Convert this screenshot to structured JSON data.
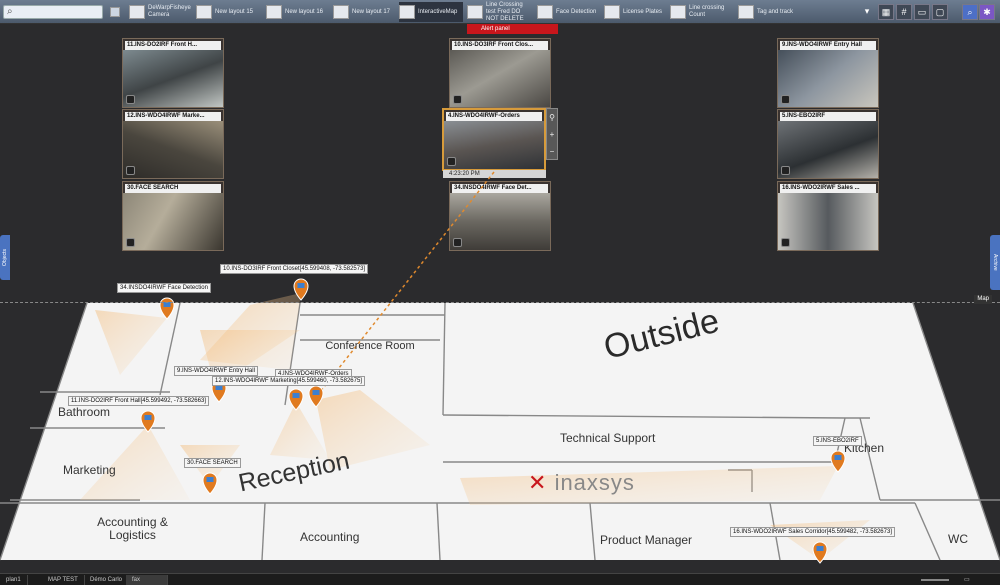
{
  "toolbar": {
    "search_placeholder": "",
    "items": [
      {
        "label": "DeWarpFisheye Camera"
      },
      {
        "label": "New layout 15"
      },
      {
        "label": "New layout 16"
      },
      {
        "label": "New layout 17"
      },
      {
        "label": "InteractiveMap"
      },
      {
        "label": "Line Crossing test Fred DO NOT DELETE"
      },
      {
        "label": "Face Detection"
      },
      {
        "label": "License Plates"
      },
      {
        "label": "Line crossing Count"
      },
      {
        "label": "Tag and track"
      }
    ]
  },
  "alert_panel": "Alert panel",
  "cameras": [
    {
      "title": "11.INS-DO2IRF Front H..."
    },
    {
      "title": "12.INS-WDO4IRWF Marke..."
    },
    {
      "title": "30.FACE SEARCH"
    },
    {
      "title": "10.INS-DO3IRF Front Clos..."
    },
    {
      "title": "4.INS-WDO4IRWF-Orders"
    },
    {
      "title": "34.INSDO4IRWF Face Det..."
    },
    {
      "title": "9.INS-WDO4IRWF Entry Hall"
    },
    {
      "title": "5.INS-EBO2IRF"
    },
    {
      "title": "16.INS-WDO2IRWF Sales ..."
    }
  ],
  "timestamp": "4:23:20 PM",
  "side_tabs": {
    "left": "Objects",
    "right": "Archive"
  },
  "map_label": "Map",
  "map": {
    "rooms": {
      "conference": "Conference Room",
      "outside": "Outside",
      "bathroom": "Bathroom",
      "technical": "Technical Support",
      "kitchen": "Kitchen",
      "marketing": "Marketing",
      "reception": "Reception",
      "accounting_logistics": "Accounting & Logistics",
      "accounting": "Accounting",
      "product_manager": "Product Manager",
      "wc": "WC"
    },
    "brand": "inaxsys",
    "camera_labels": {
      "c34": "34.INSDO4IRWF Face Detection",
      "c10": "10.INS-DO3IRF Front Closet[45.599408, -73.582573]",
      "c9": "9.INS-WDO4IRWF Entry Hall",
      "c4": "4.INS-WDO4IRWF-Orders",
      "c12": "12.INS-WDO4IRWF Marketing[45.599460, -73.582675]",
      "c11": "11.INS-DO2IRF Front Hall[45.599492, -73.582663]",
      "c30": "30.FACE SEARCH",
      "c5": "5.INS-EBO2IRF",
      "c16": "16.INS-WDO2IRWF Sales Corridor[45.599482, -73.582673]"
    }
  },
  "status_tabs": [
    "plan1",
    "MAP TEST",
    "Démo Carlo",
    "fax"
  ],
  "colors": {
    "accent": "#4a73c0",
    "alert": "#c8161c",
    "pin": "#e07a1f",
    "cone": "#f5c58a"
  }
}
